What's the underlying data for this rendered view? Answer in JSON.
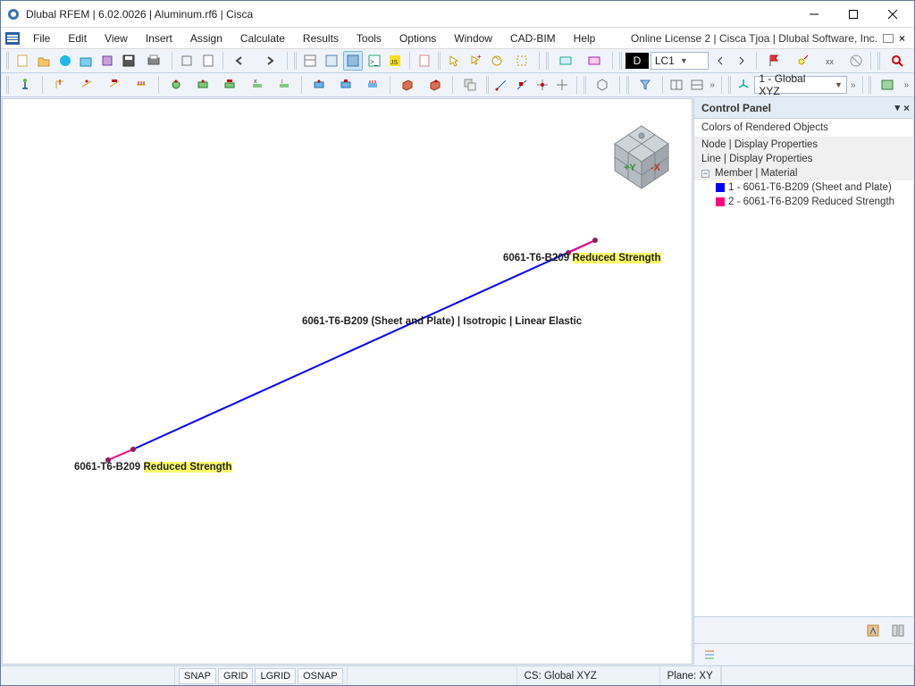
{
  "window": {
    "title": "Dlubal RFEM | 6.02.0026 | Aluminum.rf6 | Cisca"
  },
  "menubar": {
    "items": [
      "File",
      "Edit",
      "View",
      "Insert",
      "Assign",
      "Calculate",
      "Results",
      "Tools",
      "Options",
      "Window",
      "CAD-BIM",
      "Help"
    ],
    "license": "Online License 2 | Cisca Tjoa | Dlubal Software, Inc."
  },
  "toolbar2": {
    "lc_badge": "D",
    "lc_label": "LC1",
    "cs_combo": "1 - Global XYZ"
  },
  "panel": {
    "title": "Control Panel",
    "subtitle": "Colors of Rendered Objects",
    "rows": {
      "node": "Node | Display Properties",
      "line": "Line | Display Properties",
      "member": "Member | Material"
    },
    "legend": [
      {
        "color": "#0000ff",
        "label": "1 - 6061-T6-B209 (Sheet and Plate)"
      },
      {
        "color": "#ff007f",
        "label": "2 - 6061-T6-B209 Reduced Strength"
      }
    ]
  },
  "viewport": {
    "cube": {
      "y_label": "+Y",
      "x_label": "-X"
    },
    "label_top": {
      "prefix": "6061-T6-B209",
      "highlight": "Reduced Strength"
    },
    "label_mid": "6061-T6-B209 (Sheet and Plate) | Isotropic | Linear Elastic",
    "label_bottom": {
      "prefix": "6061-T6-B209",
      "highlight": "Reduced Strength"
    }
  },
  "statusbar": {
    "snap": "SNAP",
    "grid": "GRID",
    "lgrid": "LGRID",
    "osnap": "OSNAP",
    "cs": "CS: Global XYZ",
    "plane": "Plane: XY"
  }
}
